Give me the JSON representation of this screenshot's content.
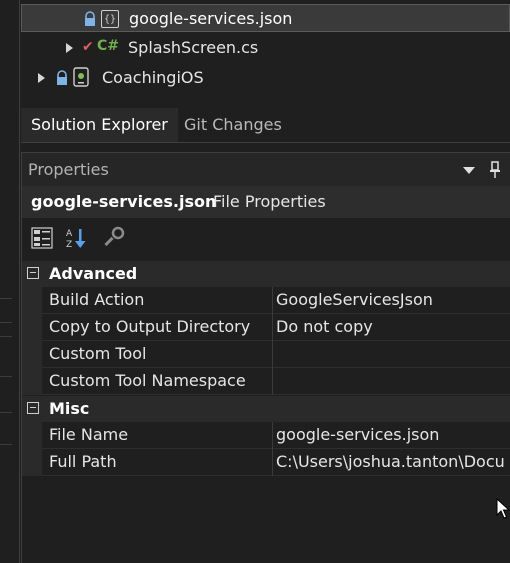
{
  "solution_tree": {
    "items": [
      {
        "label": "google-services.json",
        "icon": "json-file-icon",
        "locked": true
      },
      {
        "label": "SplashScreen.cs",
        "icon": "csharp-file-icon",
        "checked": true
      },
      {
        "label": "CoachingiOS",
        "icon": "ios-project-icon",
        "locked": true
      }
    ]
  },
  "tabs": {
    "solution_explorer": "Solution Explorer",
    "git_changes": "Git Changes"
  },
  "properties": {
    "title": "Properties",
    "object_name": "google-services.json",
    "object_type": "File Properties",
    "categories": [
      {
        "name": "Advanced",
        "rows": [
          {
            "name": "Build Action",
            "value": "GoogleServicesJson"
          },
          {
            "name": "Copy to Output Directory",
            "value": "Do not copy"
          },
          {
            "name": "Custom Tool",
            "value": ""
          },
          {
            "name": "Custom Tool Namespace",
            "value": ""
          }
        ]
      },
      {
        "name": "Misc",
        "rows": [
          {
            "name": "File Name",
            "value": "google-services.json"
          },
          {
            "name": "Full Path",
            "value": "C:\\Users\\joshua.tanton\\Docu"
          }
        ]
      }
    ]
  },
  "colors": {
    "background": "#1f1f1f",
    "panel_header": "#262626",
    "category_bg": "#2a2a2a",
    "check": "#e05d5d",
    "csharp": "#6fb04d"
  }
}
